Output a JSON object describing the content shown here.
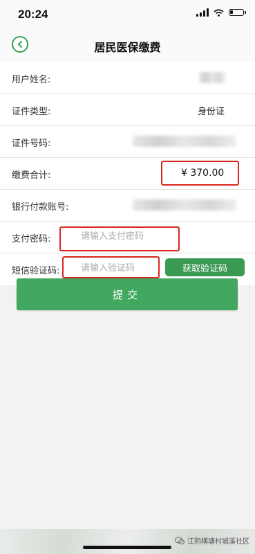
{
  "status_bar": {
    "time": "20:24"
  },
  "nav": {
    "title": "居民医保缴费"
  },
  "form": {
    "name_label": "用户姓名:",
    "id_type_label": "证件类型:",
    "id_type_value": "身份证",
    "id_number_label": "证件号码:",
    "total_label": "缴费合计:",
    "total_value": "¥  370.00",
    "bank_account_label": "银行付款账号:",
    "pay_password_label": "支付密码:",
    "pay_password_placeholder": "请输入支付密码",
    "sms_code_label": "短信验证码:",
    "sms_code_placeholder": "请输入验证码",
    "get_code_label": "获取验证码"
  },
  "submit_label": "提交",
  "watermark": "江阴横塘村城溪社区",
  "colors": {
    "accent": "#42a860",
    "highlight": "#d8261f"
  }
}
